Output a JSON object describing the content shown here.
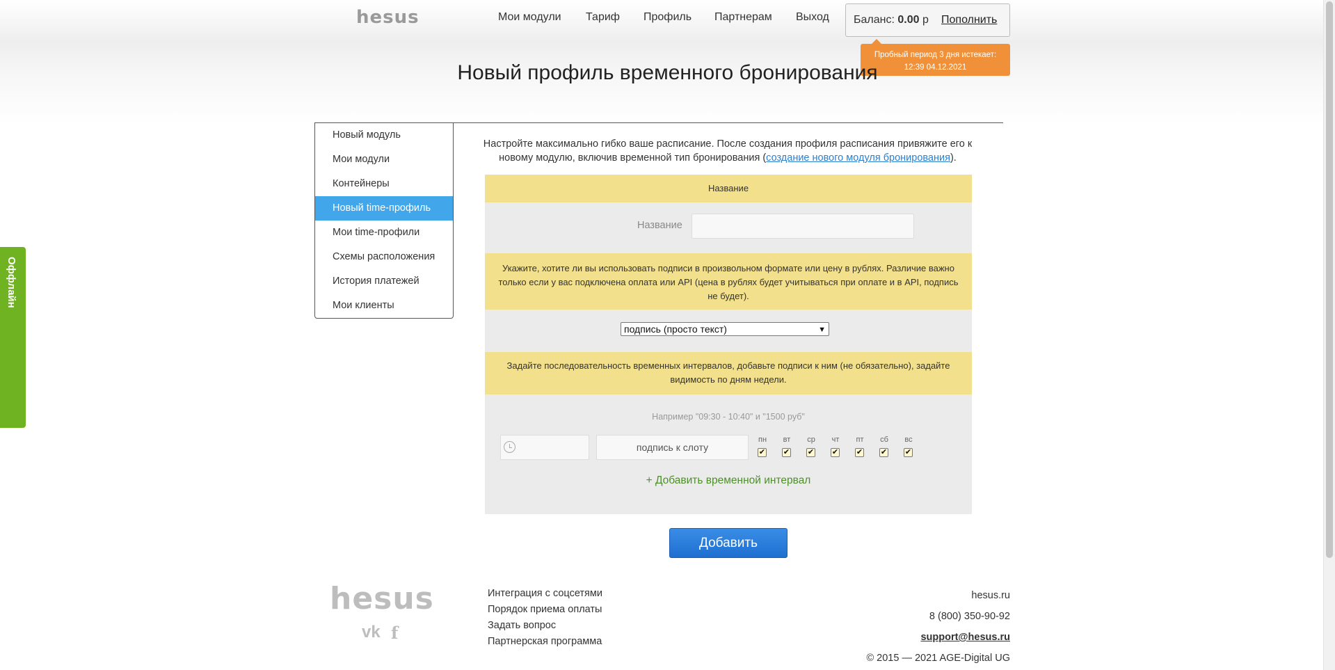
{
  "header": {
    "logo": "hesus",
    "nav": [
      "Мои модули",
      "Тариф",
      "Профиль",
      "Партнерам",
      "Выход"
    ],
    "balance_label": "Баланс:",
    "balance_value": "0.00",
    "balance_currency": "р",
    "topup_label": "Пополнить",
    "trial_line1": "Пробный период 3 дня истекает:",
    "trial_line2": "12:39 04.12.2021"
  },
  "page_title": "Новый профиль временного бронирования",
  "sidebar": {
    "items": [
      {
        "label": "Новый модуль"
      },
      {
        "label": "Мои модули"
      },
      {
        "label": "Контейнеры"
      },
      {
        "label": "Новый time-профиль",
        "active": true
      },
      {
        "label": "Мои time-профили"
      },
      {
        "label": "Схемы расположения"
      },
      {
        "label": "История платежей"
      },
      {
        "label": "Мои клиенты"
      }
    ]
  },
  "main": {
    "intro_text": "Настройте максимально гибко ваше расписание. После создания профиля расписания привяжите его к новому модулю, включив временной тип бронирования (",
    "intro_link": "создание нового модуля бронирования",
    "intro_end": ").",
    "section_name_title": "Название",
    "name_field_label": "Название",
    "name_field_value": "",
    "section_price_text": "Укажите, хотите ли вы использовать подписи в произвольном формате или цену в рублях. Различие важно только если у вас подключена оплата или API (цена в рублях будет учитываться при оплате и в API, подпись не будет).",
    "price_select_value": "подпись (просто текст)",
    "section_intervals_text": "Задайте последовательность временных интервалов, добавьте подписи к ним (не обязательно), задайте видимость по дням недели.",
    "example_text": "Например \"09:30 - 10:40\" и \"1500 руб\"",
    "slot_placeholder": "подпись к слоту",
    "days": [
      "пн",
      "вт",
      "ср",
      "чт",
      "пт",
      "сб",
      "вс"
    ],
    "days_checked": [
      true,
      true,
      true,
      true,
      true,
      true,
      true
    ],
    "add_interval_label": "+ Добавить временной интервал",
    "submit_label": "Добавить"
  },
  "footer": {
    "logo": "hesus",
    "social": [
      "vk-icon",
      "facebook-icon"
    ],
    "links": [
      "Интеграция с соцсетями",
      "Порядок приема оплаты",
      "Задать вопрос",
      "Партнерская программа"
    ],
    "site": "hesus.ru",
    "phone": "8 (800) 350-90-92",
    "email": "support@hesus.ru",
    "copyright": "© 2015 — 2021 AGE-Digital UG"
  },
  "offline_tab": "Оффлайн",
  "colors": {
    "accent_blue": "#42a7ea",
    "band_yellow": "#f2e08c",
    "trial_orange": "#f0913a",
    "offline_green": "#6fb222",
    "button_blue": "#1e6fd0"
  }
}
